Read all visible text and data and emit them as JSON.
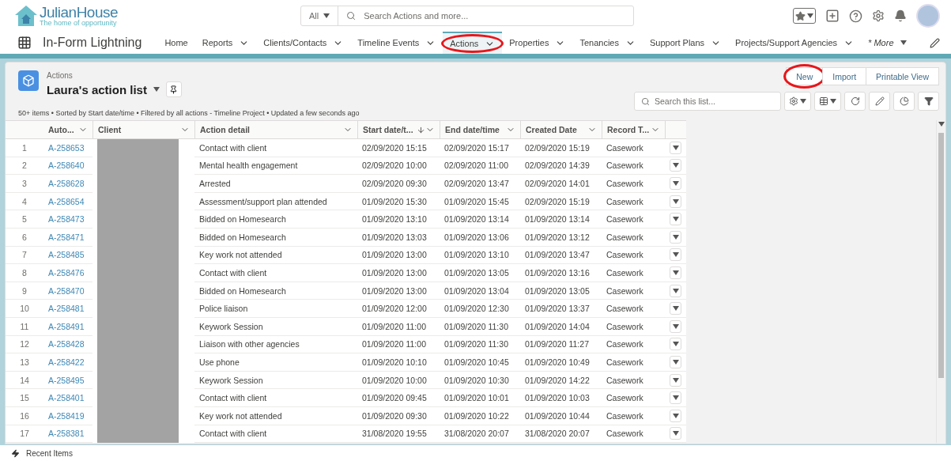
{
  "brand": {
    "name": "JulianHouse",
    "tagline": "The home of opportunity"
  },
  "global_search": {
    "scope": "All",
    "placeholder": "Search Actions and more..."
  },
  "app_name": "In-Form Lightning",
  "nav": [
    {
      "label": "Home",
      "menu": false,
      "selected": false,
      "highlighted": false
    },
    {
      "label": "Reports",
      "menu": true,
      "selected": false,
      "highlighted": false
    },
    {
      "label": "Clients/Contacts",
      "menu": true,
      "selected": false,
      "highlighted": false
    },
    {
      "label": "Timeline Events",
      "menu": true,
      "selected": false,
      "highlighted": false
    },
    {
      "label": "Actions",
      "menu": true,
      "selected": true,
      "highlighted": true
    },
    {
      "label": "Properties",
      "menu": true,
      "selected": false,
      "highlighted": false
    },
    {
      "label": "Tenancies",
      "menu": true,
      "selected": false,
      "highlighted": false
    },
    {
      "label": "Support Plans",
      "menu": true,
      "selected": false,
      "highlighted": false
    },
    {
      "label": "Projects/Support Agencies",
      "menu": true,
      "selected": false,
      "highlighted": false
    }
  ],
  "more": "* More",
  "list": {
    "object": "Actions",
    "title": "Laura's action list",
    "info": "50+ items • Sorted by Start date/time • Filtered by all actions - Timeline Project • Updated a few seconds ago",
    "search_placeholder": "Search this list..."
  },
  "buttons": [
    {
      "label": "New",
      "highlighted": true
    },
    {
      "label": "Import",
      "highlighted": false
    },
    {
      "label": "Printable View",
      "highlighted": false
    }
  ],
  "table": {
    "columns": [
      {
        "label": "Auto...",
        "sorted": false
      },
      {
        "label": "Client",
        "sorted": false
      },
      {
        "label": "Action detail",
        "sorted": false
      },
      {
        "label": "Start date/t...",
        "sorted": true
      },
      {
        "label": "End date/time",
        "sorted": false
      },
      {
        "label": "Created Date",
        "sorted": false
      },
      {
        "label": "Record T...",
        "sorted": false
      }
    ],
    "rows": [
      {
        "n": "1",
        "id": "A-258653",
        "redacted": true,
        "detail": "Contact with client",
        "start": "02/09/2020 15:15",
        "end": "02/09/2020 15:17",
        "created": "02/09/2020 15:19",
        "type": "Casework"
      },
      {
        "n": "2",
        "id": "A-258640",
        "redacted": true,
        "detail": "Mental health engagement",
        "start": "02/09/2020 10:00",
        "end": "02/09/2020 11:00",
        "created": "02/09/2020 14:39",
        "type": "Casework"
      },
      {
        "n": "3",
        "id": "A-258628",
        "redacted": true,
        "detail": "Arrested",
        "start": "02/09/2020 09:30",
        "end": "02/09/2020 13:47",
        "created": "02/09/2020 14:01",
        "type": "Casework"
      },
      {
        "n": "4",
        "id": "A-258654",
        "redacted": true,
        "detail": "Assessment/support plan attended",
        "start": "01/09/2020 15:30",
        "end": "01/09/2020 15:45",
        "created": "02/09/2020 15:19",
        "type": "Casework"
      },
      {
        "n": "5",
        "id": "A-258473",
        "redacted": true,
        "detail": "Bidded on Homesearch",
        "start": "01/09/2020 13:10",
        "end": "01/09/2020 13:14",
        "created": "01/09/2020 13:14",
        "type": "Casework"
      },
      {
        "n": "6",
        "id": "A-258471",
        "redacted": true,
        "detail": "Bidded on Homesearch",
        "start": "01/09/2020 13:03",
        "end": "01/09/2020 13:06",
        "created": "01/09/2020 13:12",
        "type": "Casework"
      },
      {
        "n": "7",
        "id": "A-258485",
        "redacted": true,
        "detail": "Key work not attended",
        "start": "01/09/2020 13:00",
        "end": "01/09/2020 13:10",
        "created": "01/09/2020 13:47",
        "type": "Casework"
      },
      {
        "n": "8",
        "id": "A-258476",
        "redacted": true,
        "detail": "Contact with client",
        "start": "01/09/2020 13:00",
        "end": "01/09/2020 13:05",
        "created": "01/09/2020 13:16",
        "type": "Casework"
      },
      {
        "n": "9",
        "id": "A-258470",
        "redacted": true,
        "detail": "Bidded on Homesearch",
        "start": "01/09/2020 13:00",
        "end": "01/09/2020 13:04",
        "created": "01/09/2020 13:05",
        "type": "Casework"
      },
      {
        "n": "10",
        "id": "A-258481",
        "redacted": true,
        "detail": "Police liaison",
        "start": "01/09/2020 12:00",
        "end": "01/09/2020 12:30",
        "created": "01/09/2020 13:37",
        "type": "Casework"
      },
      {
        "n": "11",
        "id": "A-258491",
        "redacted": true,
        "detail": "Keywork Session",
        "start": "01/09/2020 11:00",
        "end": "01/09/2020 11:30",
        "created": "01/09/2020 14:04",
        "type": "Casework"
      },
      {
        "n": "12",
        "id": "A-258428",
        "redacted": true,
        "detail": "Liaison with other agencies",
        "start": "01/09/2020 11:00",
        "end": "01/09/2020 11:30",
        "created": "01/09/2020 11:27",
        "type": "Casework"
      },
      {
        "n": "13",
        "id": "A-258422",
        "redacted": true,
        "detail": "Use phone",
        "start": "01/09/2020 10:10",
        "end": "01/09/2020 10:45",
        "created": "01/09/2020 10:49",
        "type": "Casework"
      },
      {
        "n": "14",
        "id": "A-258495",
        "redacted": true,
        "detail": "Keywork Session",
        "start": "01/09/2020 10:00",
        "end": "01/09/2020 10:30",
        "created": "01/09/2020 14:22",
        "type": "Casework"
      },
      {
        "n": "15",
        "id": "A-258401",
        "redacted": true,
        "detail": "Contact with client",
        "start": "01/09/2020 09:45",
        "end": "01/09/2020 10:01",
        "created": "01/09/2020 10:03",
        "type": "Casework"
      },
      {
        "n": "16",
        "id": "A-258419",
        "redacted": true,
        "detail": "Key work not attended",
        "start": "01/09/2020 09:30",
        "end": "01/09/2020 10:22",
        "created": "01/09/2020 10:44",
        "type": "Casework"
      },
      {
        "n": "17",
        "id": "A-258381",
        "redacted": true,
        "detail": "Contact with client",
        "start": "31/08/2020 19:55",
        "end": "31/08/2020 20:07",
        "created": "31/08/2020 20:07",
        "type": "Casework"
      }
    ]
  },
  "footer": "Recent Items"
}
